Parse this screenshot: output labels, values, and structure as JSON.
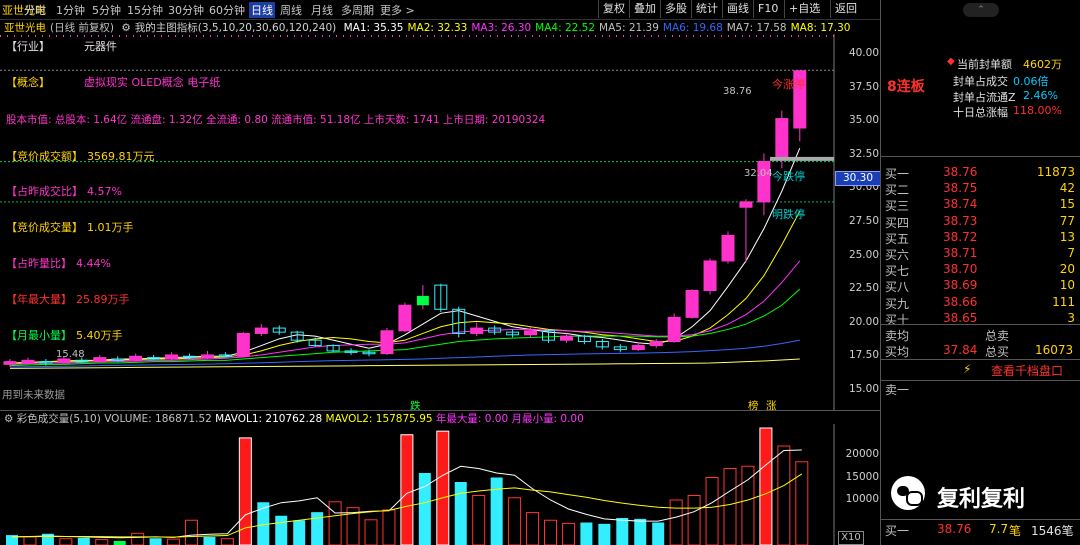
{
  "toolbar": {
    "stock_name": "亚世光电",
    "items": [
      "分时",
      "1分钟",
      "5分钟",
      "15分钟",
      "30分钟",
      "60分钟",
      "日线",
      "周线",
      "月线",
      "多周期",
      "更多 >"
    ],
    "active": "日线",
    "right_items": [
      "复权",
      "叠加",
      "多股",
      "统计",
      "画线",
      "F10",
      "+自选",
      "返回"
    ]
  },
  "indicator_line": {
    "label": "(日线 前复权)",
    "title": "我的主图指标(3,5,10,20,30,60,120,240)",
    "ma": [
      {
        "name": "MA1",
        "value": "35.35",
        "color": "#ffffff"
      },
      {
        "name": "MA2",
        "value": "32.33",
        "color": "#ffff00"
      },
      {
        "name": "MA3",
        "value": "26.30",
        "color": "#ff33ff"
      },
      {
        "name": "MA4",
        "value": "22.52",
        "color": "#00ff00"
      },
      {
        "name": "MA5",
        "value": "21.39",
        "color": "#c0c0c0"
      },
      {
        "name": "MA6",
        "value": "19.68",
        "color": "#3366ff"
      },
      {
        "name": "MA7",
        "value": "17.58",
        "color": "#c0c0c0"
      },
      {
        "name": "MA8",
        "value": "17.30",
        "color": "#ffff00"
      }
    ]
  },
  "overlays": {
    "industry_label": "【行业】",
    "industry_value": "元器件",
    "concept_label": "【概念】",
    "concept_value": "虚拟现实 OLED概念 电子纸",
    "capital_line": "股本市值: 总股本: 1.64亿 流通盘: 1.32亿 全流通: 0.80 流通市值: 51.18亿 上市天数: 1741 上市日期: 20190324",
    "auction_amount_label": "【竞价成交额】",
    "auction_amount_value": "3569.81万元",
    "prev_deal_ratio_label": "【占昨成交比】",
    "prev_deal_ratio_value": "4.57%",
    "auction_volume_label": "【竞价成交量】",
    "auction_volume_value": "1.01万手",
    "prev_vol_ratio_label": "【占昨量比】",
    "prev_vol_ratio_value": "4.44%",
    "year_max_label": "【年最大量】",
    "year_max_value": "25.89万手",
    "month_min_label": "【月最小量】",
    "month_min_value": "5.40万手",
    "future_data": "用到未来数据",
    "low_price": "15.48",
    "peak_price": "38.76",
    "limit_up_label": "今涨停",
    "limit_down_label": "今跌停",
    "tomorrow_down_label": "明跌停",
    "limit_down_price": "32.04",
    "current_price_tag": "30.30",
    "marker_die": "跌",
    "marker_bang": "榜",
    "marker_zhang": "涨"
  },
  "price_axis": [
    "40.00",
    "37.50",
    "35.00",
    "32.50",
    "30.00",
    "27.50",
    "25.00",
    "22.50",
    "20.00",
    "17.50",
    "15.00"
  ],
  "volume_line": {
    "name": "彩色成交量(5,10)",
    "volume": "VOLUME: 186871.52",
    "mavol1": "MAVOL1: 210762.28",
    "mavol2": "MAVOL2: 157875.95",
    "year_max": "年最大量: 0.00",
    "month_min": "月最小量: 0.00"
  },
  "volume_axis": [
    "20000",
    "15000",
    "10000"
  ],
  "volume_unit": "X10",
  "chart_data": {
    "type": "bar",
    "price_ylim": [
      13.5,
      41.5
    ],
    "volume_ylim": [
      0,
      26000
    ],
    "candles": [
      {
        "o": 16.9,
        "c": 17.1,
        "h": 17.3,
        "l": 16.7
      },
      {
        "o": 17.0,
        "c": 17.2,
        "h": 17.4,
        "l": 16.9
      },
      {
        "o": 17.1,
        "c": 17.0,
        "h": 17.3,
        "l": 16.8
      },
      {
        "o": 17.0,
        "c": 17.3,
        "h": 17.5,
        "l": 16.9
      },
      {
        "o": 17.2,
        "c": 17.1,
        "h": 17.4,
        "l": 17.0
      },
      {
        "o": 17.1,
        "c": 17.4,
        "h": 17.6,
        "l": 17.0
      },
      {
        "o": 17.3,
        "c": 17.2,
        "h": 17.5,
        "l": 17.1
      },
      {
        "o": 17.2,
        "c": 17.5,
        "h": 17.7,
        "l": 17.1
      },
      {
        "o": 17.4,
        "c": 17.3,
        "h": 17.6,
        "l": 17.2
      },
      {
        "o": 17.3,
        "c": 17.6,
        "h": 17.8,
        "l": 17.2
      },
      {
        "o": 17.5,
        "c": 17.4,
        "h": 17.7,
        "l": 17.3
      },
      {
        "o": 17.4,
        "c": 17.6,
        "h": 17.9,
        "l": 17.3
      },
      {
        "o": 17.6,
        "c": 17.5,
        "h": 17.8,
        "l": 17.4
      },
      {
        "o": 17.5,
        "c": 19.2,
        "h": 19.3,
        "l": 17.4
      },
      {
        "o": 19.2,
        "c": 19.6,
        "h": 19.9,
        "l": 19.0
      },
      {
        "o": 19.6,
        "c": 19.3,
        "h": 19.8,
        "l": 19.1
      },
      {
        "o": 19.3,
        "c": 18.7,
        "h": 19.4,
        "l": 18.5
      },
      {
        "o": 18.7,
        "c": 18.3,
        "h": 18.9,
        "l": 18.2
      },
      {
        "o": 18.3,
        "c": 17.9,
        "h": 18.4,
        "l": 17.8
      },
      {
        "o": 17.9,
        "c": 17.8,
        "h": 18.1,
        "l": 17.6
      },
      {
        "o": 17.8,
        "c": 17.7,
        "h": 18.0,
        "l": 17.5
      },
      {
        "o": 17.7,
        "c": 19.4,
        "h": 19.6,
        "l": 17.6
      },
      {
        "o": 19.4,
        "c": 21.3,
        "h": 21.5,
        "l": 19.3
      },
      {
        "o": 21.3,
        "c": 22.0,
        "h": 22.8,
        "l": 21.0
      },
      {
        "o": 22.8,
        "c": 21.0,
        "h": 22.9,
        "l": 20.8
      },
      {
        "o": 21.0,
        "c": 19.2,
        "h": 21.2,
        "l": 18.9
      },
      {
        "o": 19.2,
        "c": 19.6,
        "h": 20.0,
        "l": 19.0
      },
      {
        "o": 19.6,
        "c": 19.3,
        "h": 19.8,
        "l": 19.1
      },
      {
        "o": 19.3,
        "c": 19.1,
        "h": 19.5,
        "l": 18.9
      },
      {
        "o": 19.1,
        "c": 19.4,
        "h": 19.7,
        "l": 18.9
      },
      {
        "o": 19.4,
        "c": 18.7,
        "h": 19.5,
        "l": 18.5
      },
      {
        "o": 18.7,
        "c": 19.0,
        "h": 19.2,
        "l": 18.5
      },
      {
        "o": 19.0,
        "c": 18.6,
        "h": 19.1,
        "l": 18.4
      },
      {
        "o": 18.6,
        "c": 18.2,
        "h": 18.8,
        "l": 18.0
      },
      {
        "o": 18.2,
        "c": 18.0,
        "h": 18.4,
        "l": 17.8
      },
      {
        "o": 18.0,
        "c": 18.3,
        "h": 18.5,
        "l": 17.9
      },
      {
        "o": 18.3,
        "c": 18.6,
        "h": 18.8,
        "l": 18.1
      },
      {
        "o": 18.6,
        "c": 20.4,
        "h": 20.7,
        "l": 18.5
      },
      {
        "o": 20.4,
        "c": 22.4,
        "h": 22.5,
        "l": 20.3
      },
      {
        "o": 22.4,
        "c": 24.6,
        "h": 24.8,
        "l": 22.1
      },
      {
        "o": 24.6,
        "c": 26.5,
        "h": 26.8,
        "l": 24.4
      },
      {
        "o": 28.6,
        "c": 29.0,
        "h": 29.2,
        "l": 24.5
      },
      {
        "o": 29.0,
        "c": 32.0,
        "h": 32.6,
        "l": 28.0
      },
      {
        "o": 32.2,
        "c": 35.2,
        "h": 35.8,
        "l": 31.5
      },
      {
        "o": 34.5,
        "c": 38.76,
        "h": 38.8,
        "l": 33.5
      }
    ],
    "ma_series": [
      {
        "name": "MA1",
        "color": "#ffffff",
        "values": [
          17.0,
          17.05,
          17.1,
          17.15,
          17.2,
          17.2,
          17.3,
          17.3,
          17.35,
          17.4,
          17.45,
          17.5,
          17.5,
          17.8,
          18.3,
          18.8,
          19.1,
          19.0,
          18.7,
          18.4,
          18.1,
          18.4,
          19.1,
          19.9,
          20.7,
          20.9,
          20.5,
          20.1,
          19.7,
          19.5,
          19.3,
          19.2,
          19.0,
          18.9,
          18.7,
          18.5,
          18.4,
          18.8,
          19.7,
          20.9,
          22.7,
          24.6,
          27.0,
          29.8,
          33.0
        ]
      },
      {
        "name": "MA2",
        "color": "#ffff00",
        "values": [
          17.0,
          17.0,
          17.1,
          17.1,
          17.15,
          17.2,
          17.2,
          17.25,
          17.3,
          17.3,
          17.35,
          17.4,
          17.45,
          17.6,
          17.9,
          18.3,
          18.6,
          18.8,
          18.9,
          18.8,
          18.6,
          18.5,
          18.7,
          19.2,
          19.7,
          20.0,
          20.1,
          20.0,
          19.9,
          19.7,
          19.5,
          19.4,
          19.3,
          19.1,
          19.0,
          18.8,
          18.6,
          18.6,
          19.0,
          19.6,
          20.6,
          21.8,
          23.5,
          25.8,
          28.3
        ]
      },
      {
        "name": "MA3",
        "color": "#ff33ff",
        "values": [
          16.9,
          16.95,
          17.0,
          17.0,
          17.05,
          17.1,
          17.1,
          17.15,
          17.2,
          17.2,
          17.25,
          17.3,
          17.35,
          17.45,
          17.6,
          17.8,
          18.0,
          18.2,
          18.3,
          18.35,
          18.4,
          18.4,
          18.5,
          18.8,
          19.1,
          19.3,
          19.4,
          19.45,
          19.5,
          19.5,
          19.45,
          19.4,
          19.35,
          19.3,
          19.2,
          19.1,
          19.0,
          19.0,
          19.1,
          19.4,
          19.9,
          20.6,
          21.6,
          23.0,
          24.6
        ]
      },
      {
        "name": "MA4",
        "color": "#00ff00",
        "values": [
          16.8,
          16.85,
          16.9,
          16.9,
          16.95,
          17.0,
          17.0,
          17.05,
          17.1,
          17.1,
          17.15,
          17.2,
          17.2,
          17.3,
          17.4,
          17.5,
          17.6,
          17.7,
          17.8,
          17.85,
          17.9,
          17.95,
          18.0,
          18.2,
          18.4,
          18.6,
          18.7,
          18.8,
          18.85,
          18.9,
          18.95,
          19.0,
          19.0,
          19.0,
          19.0,
          19.0,
          18.95,
          18.95,
          19.0,
          19.2,
          19.5,
          19.9,
          20.5,
          21.3,
          22.5
        ]
      },
      {
        "name": "MA6",
        "color": "#3366ff",
        "values": [
          16.7,
          16.72,
          16.74,
          16.76,
          16.78,
          16.8,
          16.82,
          16.84,
          16.86,
          16.88,
          16.9,
          16.92,
          16.94,
          16.98,
          17.02,
          17.06,
          17.1,
          17.14,
          17.18,
          17.2,
          17.22,
          17.24,
          17.27,
          17.3,
          17.35,
          17.4,
          17.45,
          17.5,
          17.55,
          17.6,
          17.62,
          17.65,
          17.68,
          17.7,
          17.72,
          17.74,
          17.76,
          17.8,
          17.85,
          17.92,
          18.0,
          18.1,
          18.25,
          18.45,
          18.7
        ]
      },
      {
        "name": "MA8",
        "color": "#ffff66",
        "values": [
          16.6,
          16.61,
          16.62,
          16.63,
          16.64,
          16.65,
          16.66,
          16.67,
          16.68,
          16.69,
          16.7,
          16.71,
          16.72,
          16.73,
          16.74,
          16.75,
          16.76,
          16.77,
          16.78,
          16.79,
          16.8,
          16.81,
          16.82,
          16.83,
          16.84,
          16.85,
          16.86,
          16.87,
          16.88,
          16.89,
          16.9,
          16.91,
          16.92,
          16.93,
          16.94,
          16.95,
          16.96,
          16.97,
          16.98,
          17.0,
          17.05,
          17.1,
          17.15,
          17.22,
          17.3
        ]
      }
    ],
    "volume": [
      {
        "v": 2200,
        "c": "cyan"
      },
      {
        "v": 1800,
        "c": "red"
      },
      {
        "v": 2500,
        "c": "cyan"
      },
      {
        "v": 1400,
        "c": "red"
      },
      {
        "v": 1600,
        "c": "cyan"
      },
      {
        "v": 1200,
        "c": "red"
      },
      {
        "v": 900,
        "c": "green"
      },
      {
        "v": 2600,
        "c": "red"
      },
      {
        "v": 1500,
        "c": "cyan"
      },
      {
        "v": 1300,
        "c": "red"
      },
      {
        "v": 5500,
        "c": "red"
      },
      {
        "v": 1800,
        "c": "cyan"
      },
      {
        "v": 1400,
        "c": "red"
      },
      {
        "v": 23800,
        "c": "red_solid"
      },
      {
        "v": 9500,
        "c": "cyan"
      },
      {
        "v": 6500,
        "c": "cyan"
      },
      {
        "v": 5500,
        "c": "cyan"
      },
      {
        "v": 7300,
        "c": "cyan"
      },
      {
        "v": 9600,
        "c": "red"
      },
      {
        "v": 8300,
        "c": "red"
      },
      {
        "v": 5600,
        "c": "red"
      },
      {
        "v": 7800,
        "c": "red"
      },
      {
        "v": 24500,
        "c": "red_solid"
      },
      {
        "v": 16000,
        "c": "cyan"
      },
      {
        "v": 25300,
        "c": "red_solid"
      },
      {
        "v": 14000,
        "c": "cyan"
      },
      {
        "v": 11000,
        "c": "red"
      },
      {
        "v": 15000,
        "c": "cyan"
      },
      {
        "v": 10500,
        "c": "red"
      },
      {
        "v": 7200,
        "c": "red"
      },
      {
        "v": 5500,
        "c": "red"
      },
      {
        "v": 4800,
        "c": "red"
      },
      {
        "v": 5000,
        "c": "cyan"
      },
      {
        "v": 4700,
        "c": "cyan"
      },
      {
        "v": 6000,
        "c": "cyan"
      },
      {
        "v": 5800,
        "c": "cyan"
      },
      {
        "v": 5000,
        "c": "cyan"
      },
      {
        "v": 10000,
        "c": "red"
      },
      {
        "v": 11000,
        "c": "red"
      },
      {
        "v": 15000,
        "c": "red"
      },
      {
        "v": 17000,
        "c": "red"
      },
      {
        "v": 17500,
        "c": "red"
      },
      {
        "v": 26000,
        "c": "red_solid"
      },
      {
        "v": 22000,
        "c": "red"
      },
      {
        "v": 18500,
        "c": "red"
      }
    ],
    "mavol1": [
      1800,
      1900,
      2000,
      1900,
      1800,
      1700,
      1600,
      1700,
      1800,
      1700,
      2200,
      2400,
      2500,
      6700,
      8200,
      9400,
      9800,
      10500,
      7100,
      7200,
      7500,
      7600,
      11500,
      13000,
      15500,
      17500,
      17000,
      16000,
      15500,
      12500,
      10000,
      8000,
      6800,
      5800,
      5500,
      5300,
      5300,
      6200,
      7400,
      9400,
      12000,
      14500,
      17800,
      21000,
      21100
    ],
    "mavol2": [
      1800,
      1850,
      1900,
      1900,
      1900,
      1850,
      1800,
      1800,
      1800,
      1750,
      1900,
      2000,
      2100,
      3800,
      4500,
      5000,
      5500,
      6000,
      6500,
      7000,
      7400,
      7700,
      8600,
      9400,
      10500,
      11500,
      12000,
      12400,
      12700,
      12200,
      11800,
      11200,
      10600,
      9900,
      9300,
      8800,
      8400,
      8200,
      8200,
      8400,
      9000,
      10000,
      11400,
      13200,
      15800
    ]
  },
  "right_panel": {
    "header_button": "⌃",
    "board_label": "8连板",
    "sealed_amount_label": "当前封单额",
    "sealed_amount_value": "4602万",
    "sealed_deal_label": "封单占成交",
    "sealed_deal_value": "0.06倍",
    "sealed_float_label": "封单占流通Z",
    "sealed_float_value": "2.46%",
    "ten_day_label": "十日总涨幅",
    "ten_day_value": "118.00%",
    "bids": [
      {
        "label": "买一",
        "price": "38.76",
        "qty": "11873"
      },
      {
        "label": "买二",
        "price": "38.75",
        "qty": "42"
      },
      {
        "label": "买三",
        "price": "38.74",
        "qty": "15"
      },
      {
        "label": "买四",
        "price": "38.73",
        "qty": "77"
      },
      {
        "label": "买五",
        "price": "38.72",
        "qty": "13"
      },
      {
        "label": "买六",
        "price": "38.71",
        "qty": "7"
      },
      {
        "label": "买七",
        "price": "38.70",
        "qty": "20"
      },
      {
        "label": "买八",
        "price": "38.69",
        "qty": "10"
      },
      {
        "label": "买九",
        "price": "38.66",
        "qty": "111"
      },
      {
        "label": "买十",
        "price": "38.65",
        "qty": "3"
      }
    ],
    "sell_avg_label": "卖均",
    "total_sell_label": "总卖",
    "buy_avg_label": "买均",
    "buy_avg_value": "37.84",
    "total_buy_label": "总买",
    "total_buy_value": "16073",
    "view_ten_label": "查看千档盘口",
    "ask1_label": "卖一",
    "watermark": "复利复利",
    "bottom_label": "买一",
    "bottom_price": "38.76",
    "bottom_qty": "7.7",
    "bottom_unit": "笔",
    "bottom_count": "1546笔"
  }
}
